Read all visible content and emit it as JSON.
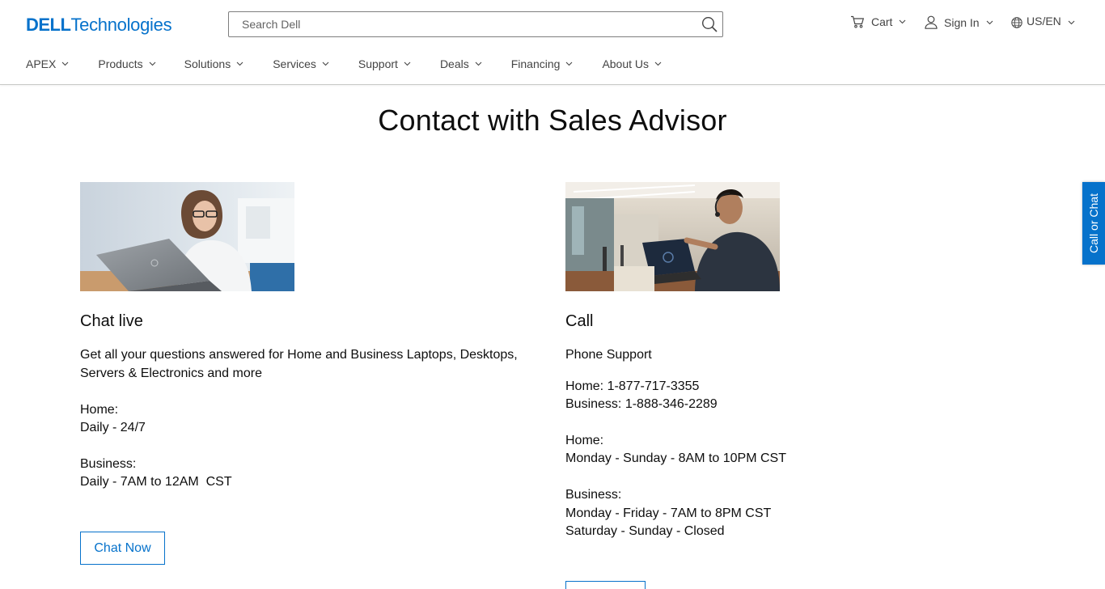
{
  "header": {
    "logo": {
      "brand": "DELL",
      "suffix": "Technologies"
    },
    "search": {
      "placeholder": "Search Dell"
    },
    "cart_label": "Cart",
    "signin_label": "Sign In",
    "locale_label": "US/EN"
  },
  "nav": {
    "items": [
      {
        "label": "APEX"
      },
      {
        "label": "Products"
      },
      {
        "label": "Solutions"
      },
      {
        "label": "Services"
      },
      {
        "label": "Support"
      },
      {
        "label": "Deals"
      },
      {
        "label": "Financing"
      },
      {
        "label": "About Us"
      }
    ]
  },
  "main": {
    "title": "Contact with Sales Advisor",
    "chat": {
      "title": "Chat live",
      "description": "Get all your questions answered for Home and Business Laptops, Desktops, Servers & Electronics and more",
      "home_label": "Home:",
      "home_hours": "Daily - 24/7",
      "business_label": "Business:",
      "business_hours": "Daily - 7AM to 12AM  CST",
      "button_label": "Chat Now"
    },
    "call": {
      "title": "Call",
      "subtitle": "Phone Support",
      "home_phone": "Home: 1-877-717-3355",
      "business_phone": "Business: 1-888-346-2289",
      "home_label": "Home:",
      "home_hours": "Monday - Sunday - 8AM to 10PM CST",
      "business_label": "Business:",
      "business_hours_weekday": "Monday - Friday - 7AM to 8PM CST",
      "business_hours_weekend": "Saturday - Sunday - Closed"
    }
  },
  "side_tab": {
    "label": "Call or Chat"
  },
  "colors": {
    "brand_blue": "#0672cb",
    "text": "#0e0e0e",
    "muted": "#444444"
  }
}
